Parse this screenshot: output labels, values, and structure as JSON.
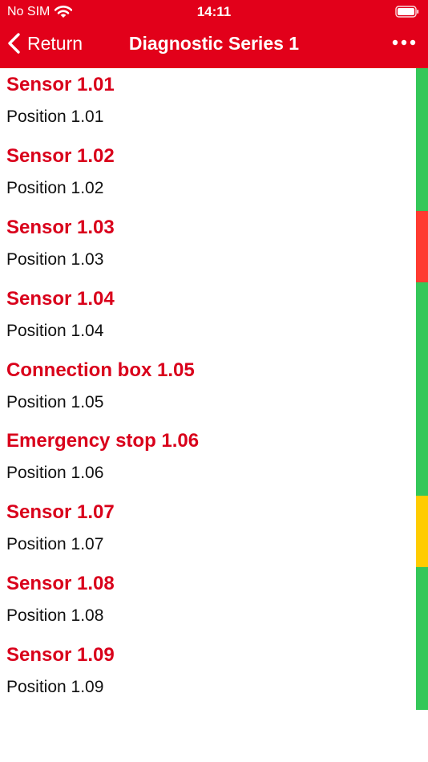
{
  "status_bar": {
    "carrier": "No SIM",
    "time": "14:11"
  },
  "nav": {
    "back_label": "Return",
    "title": "Diagnostic Series 1",
    "more_icon": "ellipsis-icon"
  },
  "status_colors": {
    "ok": "#34c759",
    "error": "#ff3b30",
    "warning": "#ffcc00"
  },
  "items": [
    {
      "title": "Sensor 1.01",
      "subtitle": "Position 1.01",
      "status": "ok"
    },
    {
      "title": "Sensor 1.02",
      "subtitle": "Position 1.02",
      "status": "ok"
    },
    {
      "title": "Sensor 1.03",
      "subtitle": "Position 1.03",
      "status": "error"
    },
    {
      "title": "Sensor 1.04",
      "subtitle": "Position 1.04",
      "status": "ok"
    },
    {
      "title": "Connection box 1.05",
      "subtitle": "Position 1.05",
      "status": "ok"
    },
    {
      "title": "Emergency stop 1.06",
      "subtitle": "Position 1.06",
      "status": "ok"
    },
    {
      "title": "Sensor 1.07",
      "subtitle": "Position 1.07",
      "status": "warning"
    },
    {
      "title": "Sensor 1.08",
      "subtitle": "Position 1.08",
      "status": "ok"
    },
    {
      "title": "Sensor 1.09",
      "subtitle": "Position 1.09",
      "status": "ok"
    }
  ]
}
